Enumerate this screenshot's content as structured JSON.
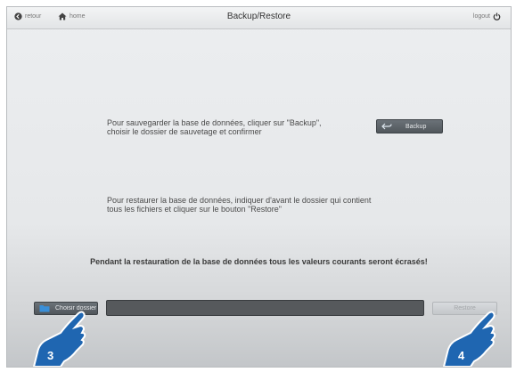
{
  "header": {
    "back_label": "retour",
    "home_label": "home",
    "title": "Backup/Restore",
    "logout_label": "logout"
  },
  "backup": {
    "text_line1": "Pour sauvegarder la base de données, cliquer sur \"Backup\",",
    "text_line2": "choisir le dossier de sauvetage et confirmer",
    "button_label": "Backup"
  },
  "restore": {
    "text_line1": "Pour restaurer la base de données, indiquer d'avant le dossier qui contient",
    "text_line2": "tous les fichiers et cliquer sur le bouton \"Restore\"",
    "warning": "Pendant la restauration de la base de données tous les valeurs courants seront écrasés!",
    "choose_folder_label": "Choisir dossier",
    "path_value": "",
    "restore_button_label": "Restore"
  },
  "callouts": {
    "step_3": "3",
    "step_4": "4"
  },
  "colors": {
    "button_dark": "#5a6065",
    "folder_icon": "#3a8fd8",
    "callout_fill": "#1f66b1"
  },
  "icons": {
    "back": "circle-arrow-left-icon",
    "home": "home-icon",
    "logout": "power-icon",
    "backup": "undo-arrow-icon",
    "folder": "folder-icon",
    "pointer": "hand-pointer-icon"
  }
}
